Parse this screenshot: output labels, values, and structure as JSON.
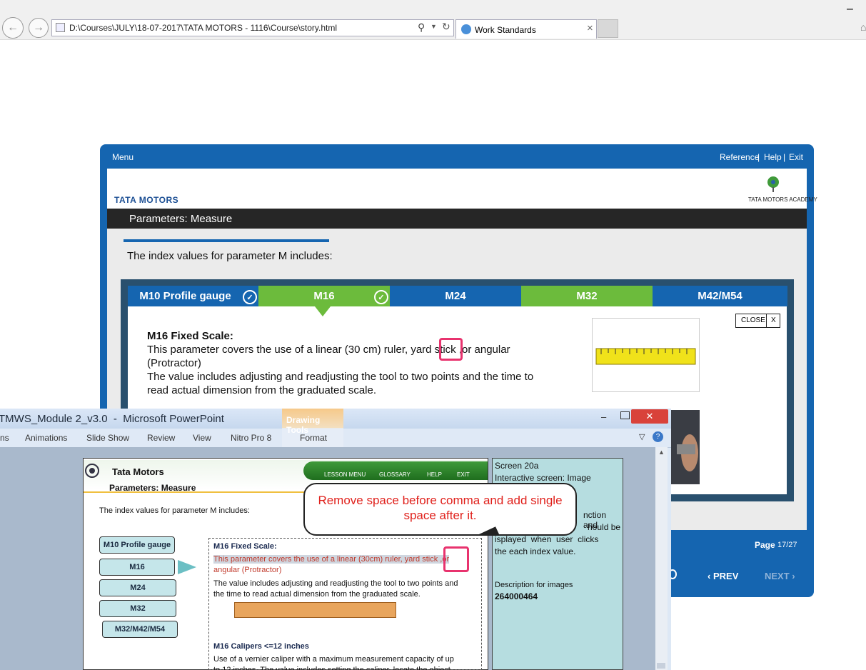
{
  "browser": {
    "address": "D:\\Courses\\JULY\\18-07-2017\\TATA MOTORS - 1116\\Course\\story.html",
    "tab_title": "Work Standards",
    "tab_close": "×"
  },
  "player": {
    "menu": "Menu",
    "reference": "Reference",
    "help": "Help",
    "exit": "Exit",
    "sep": "|",
    "brand": "TATA MOTORS",
    "academy": "TATA MOTORS ACADEMY",
    "slide_title": "Parameters: Measure",
    "intro": "The index values for parameter M includes:",
    "tabs": [
      {
        "label": "M10 Profile gauge",
        "color": "#1565b0"
      },
      {
        "label": "M16",
        "color": "#6cbb3c"
      },
      {
        "label": "M24",
        "color": "#1565b0"
      },
      {
        "label": "M32",
        "color": "#6cbb3c"
      },
      {
        "label": "M42/M54",
        "color": "#1565b0"
      }
    ],
    "close_label": "CLOSE",
    "close_x": "X",
    "heading": "M16 Fixed Scale:",
    "line1": "This parameter covers the use of a linear (30 cm) ruler, yard stick ,or angular",
    "line2": "(Protractor)",
    "line3": "The value includes adjusting and readjusting the tool to two points and the time to",
    "line4": "read actual dimension from the graduated scale.",
    "page_label": "Page",
    "page_value": "17/27",
    "prev": "PREV",
    "next": "NEXT"
  },
  "ppt": {
    "title": "TMWS_Module 2_v3.0  -  Microsoft PowerPoint",
    "drawing_tools": "Drawing Tools",
    "ribbon": [
      "ns",
      "Animations",
      "Slide Show",
      "Review",
      "View",
      "Nitro Pro 8",
      "Format"
    ],
    "slide": {
      "brand": "Tata Motors",
      "nav": [
        "LESSON MENU",
        "GLOSSARY",
        "HELP",
        "EXIT"
      ],
      "subtitle": "Parameters: Measure",
      "intro": "The index values for parameter M includes:",
      "buttons": [
        "M10 Profile gauge",
        "M16",
        "M24",
        "M32",
        "M32/M42/M54"
      ],
      "heading": "M16 Fixed Scale:",
      "red1": "This parameter covers the use of a linear (30cm) ruler, yard stick ,or",
      "red2": "angular (Protractor)",
      "body1": "The value includes adjusting and readjusting the tool to two points and",
      "body2": "the time to read actual dimension from the graduated scale.",
      "heading2": "M16 Calipers <=12 inches",
      "body3": "Use of a vernier caliper with a maximum measurement capacity of up",
      "body4": "to 12 inches. The value includes setting the caliper, locate the object"
    },
    "notes": {
      "l1": "Screen 20a",
      "l2": "Interactive screen: Image",
      "l3": "nction and",
      "l4": "hould be",
      "l5": "isplayed  when  user  clicks",
      "l6": "the each index value.",
      "l7": "Description for images",
      "l8": "264000464"
    },
    "callout": "Remove space before comma and add single space after it."
  }
}
